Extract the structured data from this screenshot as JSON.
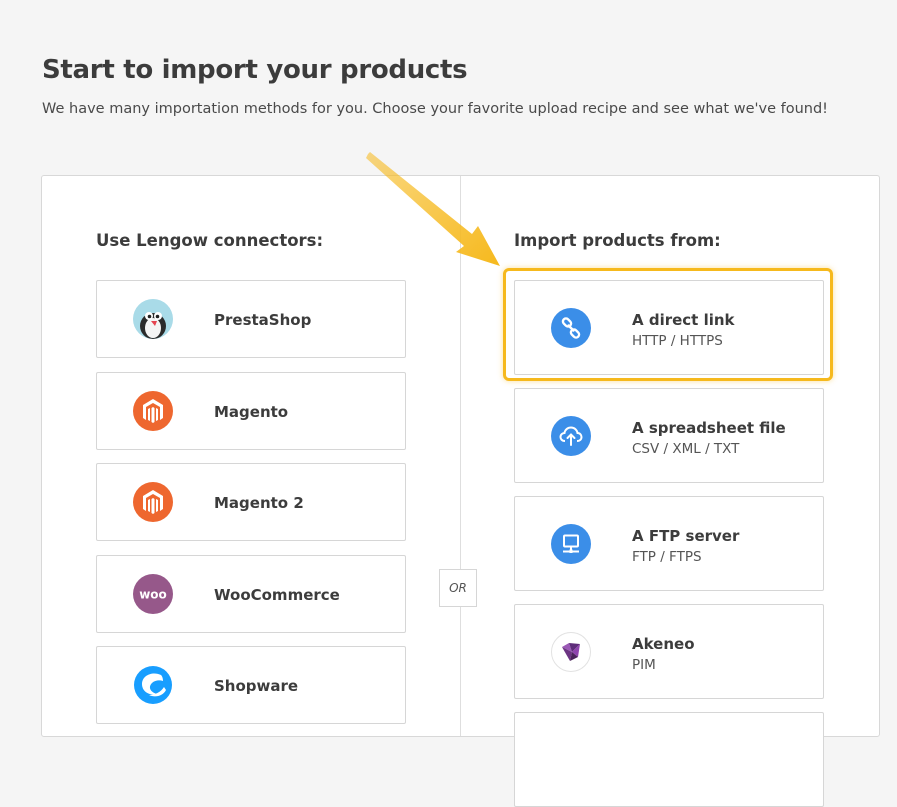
{
  "header": {
    "title": "Start to import your products",
    "subtitle": "We have many importation methods for you. Choose your favorite upload recipe and see what we've found!"
  },
  "connectors": {
    "title": "Use Lengow connectors:",
    "items": [
      {
        "label": "PrestaShop",
        "icon": "prestashop-icon"
      },
      {
        "label": "Magento",
        "icon": "magento-icon"
      },
      {
        "label": "Magento 2",
        "icon": "magento-icon"
      },
      {
        "label": "WooCommerce",
        "icon": "woocommerce-icon"
      },
      {
        "label": "Shopware",
        "icon": "shopware-icon"
      }
    ]
  },
  "separator": {
    "label": "OR"
  },
  "sources": {
    "title": "Import products from:",
    "items": [
      {
        "label": "A direct link",
        "sub": "HTTP / HTTPS",
        "icon": "link-icon"
      },
      {
        "label": "A spreadsheet file",
        "sub": "CSV / XML / TXT",
        "icon": "cloud-upload-icon"
      },
      {
        "label": "A FTP server",
        "sub": "FTP / FTPS",
        "icon": "server-icon"
      },
      {
        "label": "Akeneo",
        "sub": "PIM",
        "icon": "akeneo-icon"
      }
    ]
  },
  "colors": {
    "accent_blue": "#3b8ee8",
    "magento_orange": "#ee672f",
    "woocommerce_purple": "#96588a",
    "shopware_blue": "#189eff",
    "highlight_yellow": "#f6b91d",
    "akeneo_purple": "#5e2d7a"
  }
}
